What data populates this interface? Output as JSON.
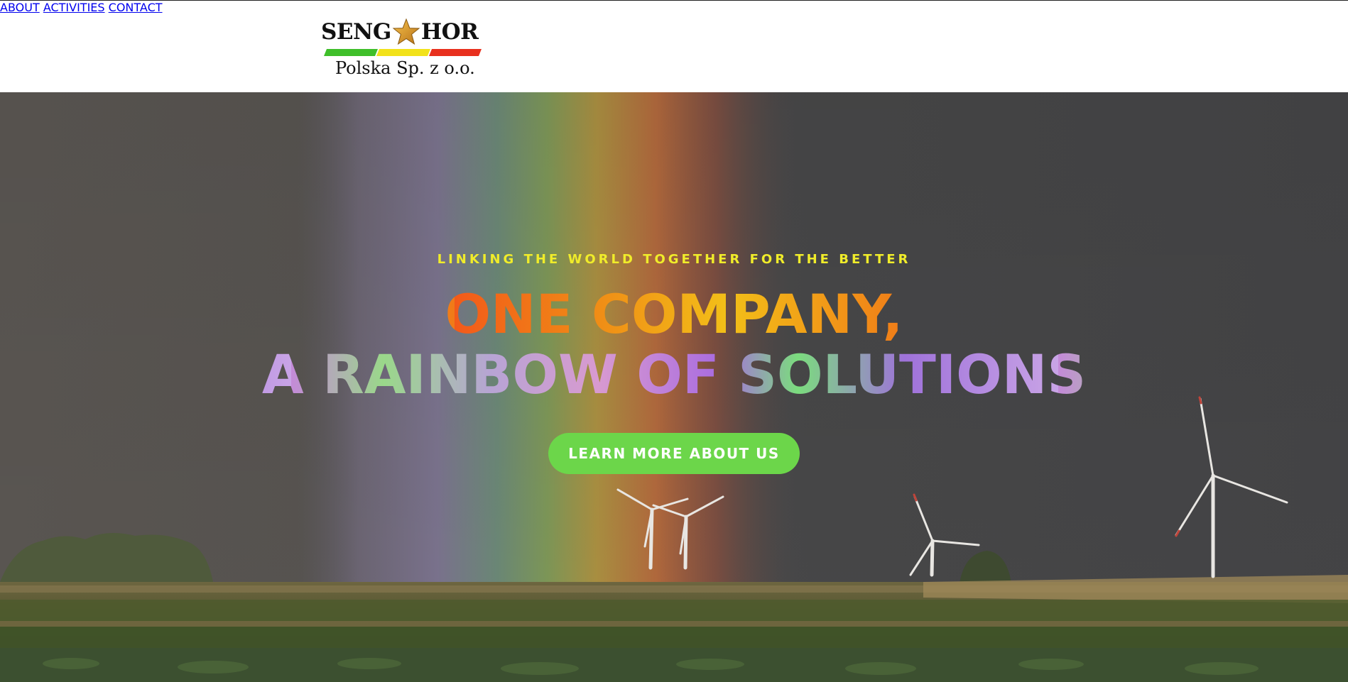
{
  "logo": {
    "word_left": "SENG",
    "word_right": "HOR",
    "subtitle": "Polska Sp. z o.o.",
    "star_icon": "gold-star",
    "stripe_colors": [
      "#3fbf2a",
      "#f2e21a",
      "#e8301e"
    ]
  },
  "nav": {
    "items": [
      {
        "label": "ABOUT"
      },
      {
        "label": "ACTIVITIES"
      },
      {
        "label": "CONTACT"
      }
    ],
    "color": "#1aa3dc"
  },
  "hero": {
    "tagline": "LINKING THE WORLD TOGETHER FOR THE BETTER",
    "headline_line1": "ONE COMPANY,",
    "headline_line2": "A RAINBOW OF SOLUTIONS",
    "cta_label": "LEARN MORE ABOUT US",
    "tagline_color": "#f0ec2a",
    "cta_color": "#6cd64a"
  }
}
